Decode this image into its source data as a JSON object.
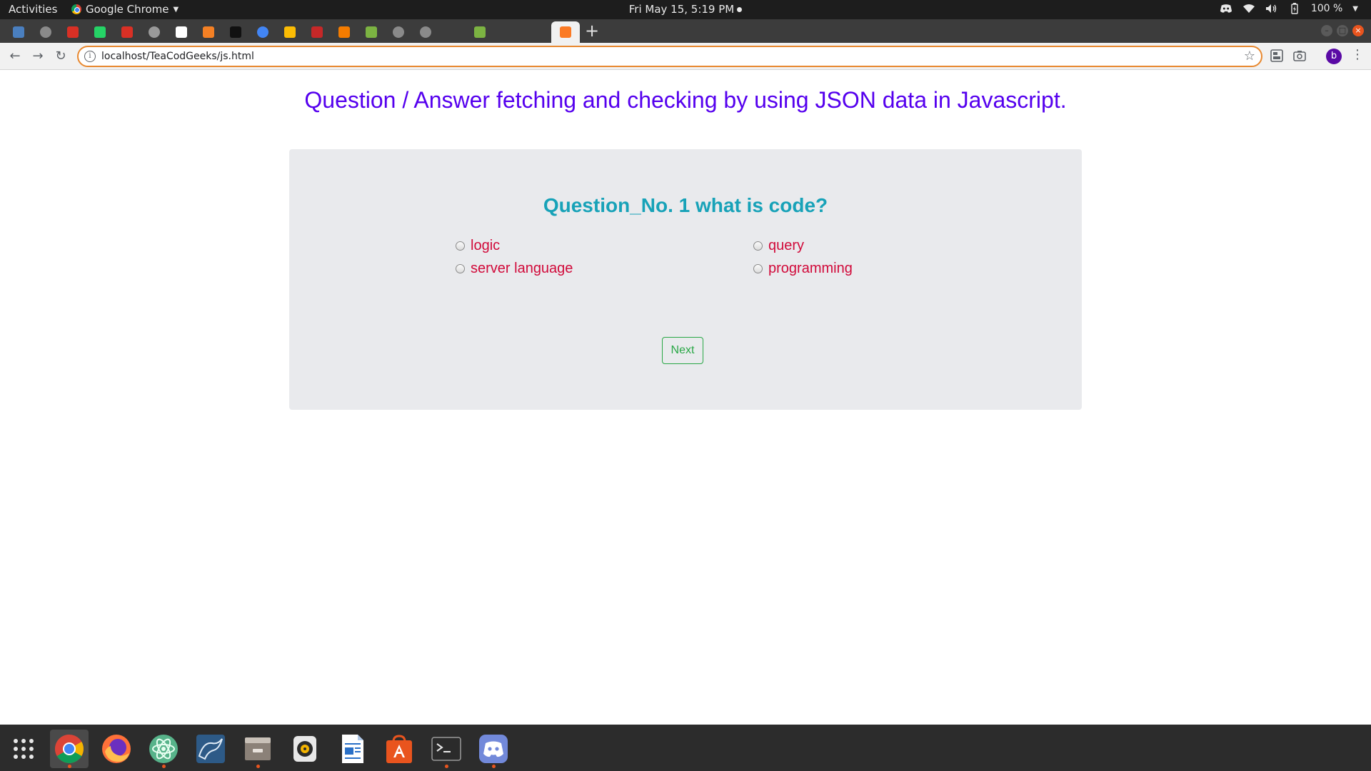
{
  "topbar": {
    "activities": "Activities",
    "app_name": "Google Chrome",
    "clock": "Fri May 15,  5:19 PM",
    "battery": "100 %"
  },
  "tabs": [
    {
      "icon": "inbox-icon",
      "color": "#4a7fbf"
    },
    {
      "icon": "globe-icon",
      "color": "#8a8a8a"
    },
    {
      "icon": "gmail-icon",
      "color": "#d93025"
    },
    {
      "icon": "whatsapp-icon",
      "color": "#25d366"
    },
    {
      "icon": "gmail-icon",
      "color": "#d93025"
    },
    {
      "icon": "github-icon",
      "color": "#9a9a9a"
    },
    {
      "icon": "codepen-icon",
      "color": "#ffffff"
    },
    {
      "icon": "stackoverflow-icon",
      "color": "#f48024"
    },
    {
      "icon": "hackerrank-icon",
      "color": "#111111"
    },
    {
      "icon": "google-icon",
      "color": "#4285f4"
    },
    {
      "icon": "keep-icon",
      "color": "#fbbc04"
    },
    {
      "icon": "scribd-icon",
      "color": "#c62828"
    },
    {
      "icon": "link-icon",
      "color": "#f57c00"
    },
    {
      "icon": "chart-icon",
      "color": "#7cb342"
    },
    {
      "icon": "globe-icon",
      "color": "#8a8a8a"
    },
    {
      "icon": "globe-icon",
      "color": "#8a8a8a"
    },
    {
      "icon": "blank-icon",
      "color": "#3c3c3c"
    },
    {
      "icon": "chart-icon",
      "color": "#7cb342"
    },
    {
      "icon": "blank-icon",
      "color": "#3c3c3c"
    },
    {
      "icon": "blank-icon",
      "color": "#3c3c3c"
    },
    {
      "icon": "xampp-icon",
      "color": "#fb7a24",
      "active": true
    }
  ],
  "toolbar": {
    "url": "localhost/TeaCodGeeks/js.html",
    "avatar_letter": "b"
  },
  "page": {
    "title": "Question / Answer fetching and checking by using JSON data in Javascript.",
    "question": "Question_No. 1  what is code?",
    "options": [
      "logic",
      "query",
      "server language",
      "programming"
    ],
    "next_label": "Next"
  },
  "colors": {
    "title": "#5500ee",
    "question": "#17a2b8",
    "option": "#d10a3a",
    "next_button": "#28a745",
    "card_background": "#e9eaed"
  },
  "dock": [
    {
      "icon": "apps-grid-icon"
    },
    {
      "icon": "chrome-icon",
      "active": true
    },
    {
      "icon": "firefox-icon"
    },
    {
      "icon": "atom-icon"
    },
    {
      "icon": "mysql-workbench-icon"
    },
    {
      "icon": "files-icon"
    },
    {
      "icon": "rhythmbox-icon"
    },
    {
      "icon": "libreoffice-writer-icon"
    },
    {
      "icon": "software-center-icon"
    },
    {
      "icon": "terminal-icon"
    },
    {
      "icon": "discord-icon"
    }
  ]
}
